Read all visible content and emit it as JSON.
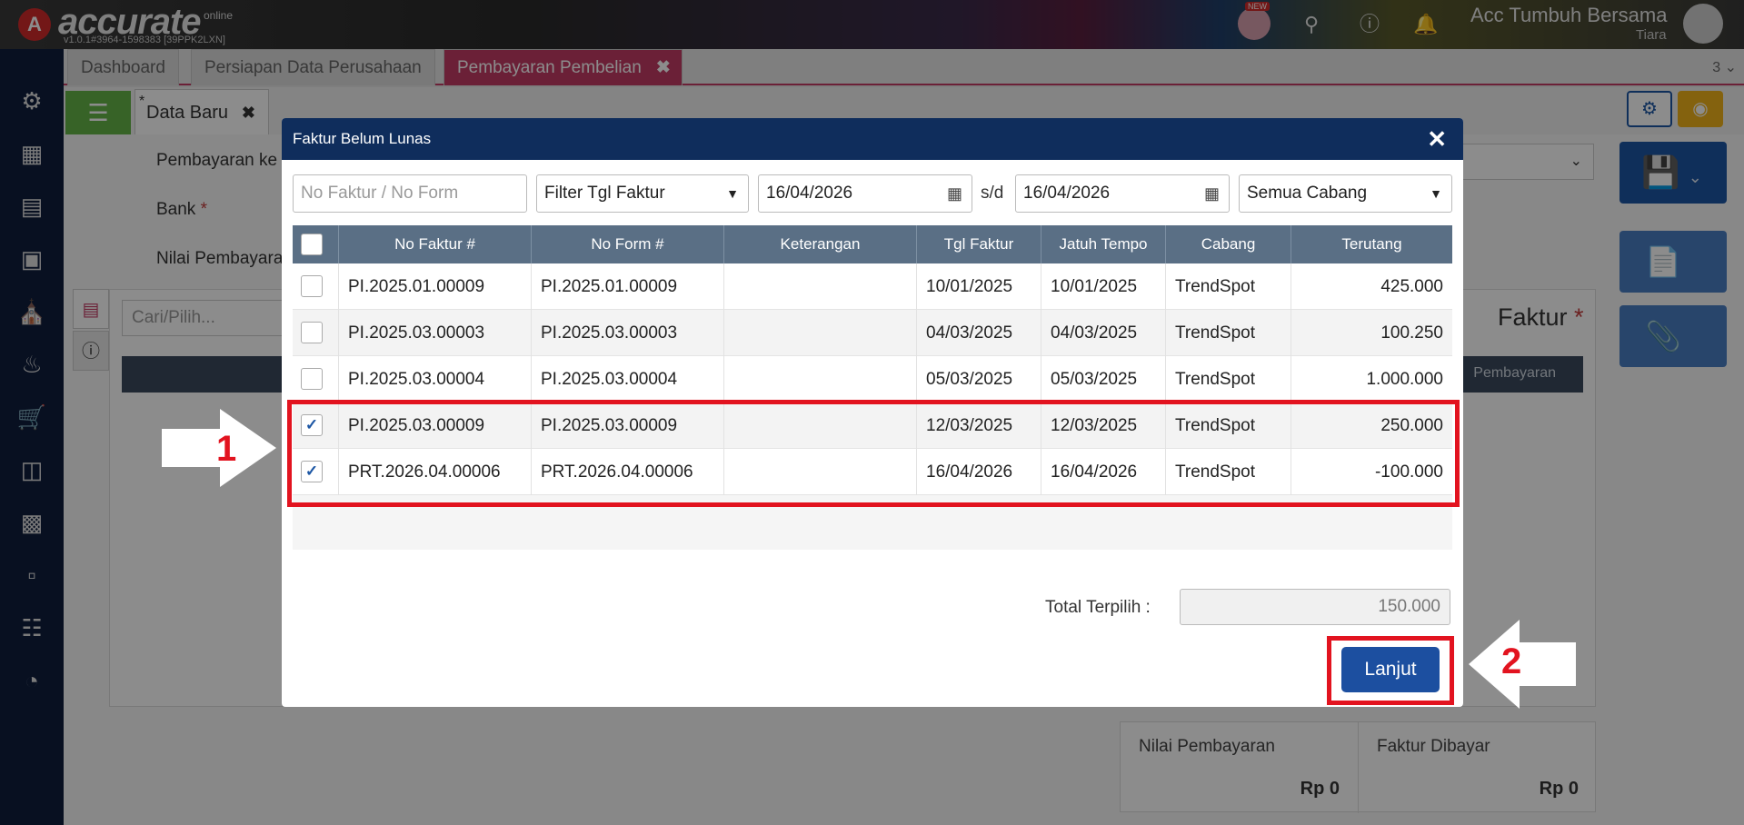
{
  "header": {
    "logo_letter": "A",
    "logo_text": "accurate",
    "logo_sub": "online",
    "version": "v1.0.1#3964-1598383 [39PPK2LXN]",
    "new_badge": "NEW",
    "company": "Acc Tumbuh Bersama",
    "user": "Tiara"
  },
  "tabs": [
    {
      "label": "Dashboard"
    },
    {
      "label": "Persiapan Data Perusahaan"
    },
    {
      "label": "Pembayaran Pembelian"
    }
  ],
  "tab_count": "3",
  "subtab": {
    "label": "Data Baru",
    "marker": "*"
  },
  "background_form": {
    "label_pembayaran": "Pembayaran ke",
    "label_bank": "Bank",
    "label_nilai": "Nilai Pembayaran",
    "search_placeholder": "Cari/Pilih...",
    "grid_head_right": "Pembayaran",
    "faktur_title": "Faktur",
    "summary": [
      {
        "label": "Nilai Pembayaran",
        "value": "Rp 0"
      },
      {
        "label": "Faktur Dibayar",
        "value": "Rp 0"
      }
    ]
  },
  "modal": {
    "title": "Faktur Belum Lunas",
    "search_placeholder": "No Faktur / No Form",
    "filter_select": "Filter Tgl Faktur",
    "date_from": "16/04/2026",
    "date_sep": "s/d",
    "date_to": "16/04/2026",
    "branch_select": "Semua Cabang",
    "columns": [
      "No Faktur #",
      "No Form #",
      "Keterangan",
      "Tgl Faktur",
      "Jatuh Tempo",
      "Cabang",
      "Terutang"
    ],
    "rows": [
      {
        "checked": false,
        "no_faktur": "PI.2025.01.00009",
        "no_form": "PI.2025.01.00009",
        "keterangan": "",
        "tgl": "10/01/2025",
        "jatuh": "10/01/2025",
        "cabang": "TrendSpot",
        "terutang": "425.000"
      },
      {
        "checked": false,
        "no_faktur": "PI.2025.03.00003",
        "no_form": "PI.2025.03.00003",
        "keterangan": "",
        "tgl": "04/03/2025",
        "jatuh": "04/03/2025",
        "cabang": "TrendSpot",
        "terutang": "100.250"
      },
      {
        "checked": false,
        "no_faktur": "PI.2025.03.00004",
        "no_form": "PI.2025.03.00004",
        "keterangan": "",
        "tgl": "05/03/2025",
        "jatuh": "05/03/2025",
        "cabang": "TrendSpot",
        "terutang": "1.000.000"
      },
      {
        "checked": true,
        "no_faktur": "PI.2025.03.00009",
        "no_form": "PI.2025.03.00009",
        "keterangan": "",
        "tgl": "12/03/2025",
        "jatuh": "12/03/2025",
        "cabang": "TrendSpot",
        "terutang": "250.000"
      },
      {
        "checked": true,
        "no_faktur": "PRT.2026.04.00006",
        "no_form": "PRT.2026.04.00006",
        "keterangan": "",
        "tgl": "16/04/2026",
        "jatuh": "16/04/2026",
        "cabang": "TrendSpot",
        "terutang": "-100.000"
      }
    ],
    "total_label": "Total Terpilih :",
    "total_value": "150.000",
    "next_button": "Lanjut"
  },
  "annotations": {
    "step1": "1",
    "step2": "2",
    "highlight_color": "#e2131f"
  },
  "colors": {
    "accent": "#c33b64",
    "primary": "#1c4fa0",
    "sidebar": "#0f1e3d",
    "modal_head": "#0f2d5c"
  }
}
